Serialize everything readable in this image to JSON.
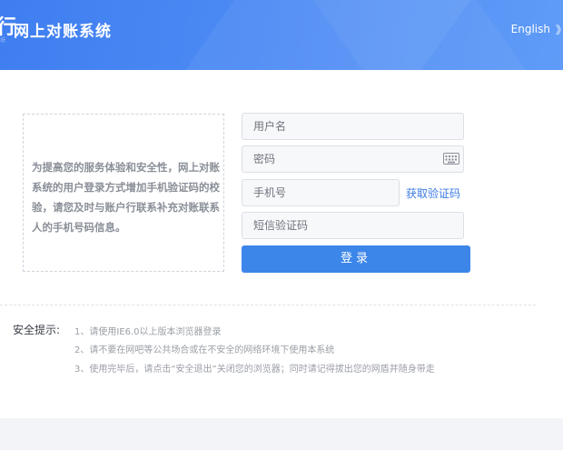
{
  "header": {
    "logo_glyph": "行",
    "logo_small": "工行",
    "title": "网上对账系统",
    "language_link": "English",
    "edge_glyph": "》"
  },
  "notice": {
    "text": "为提高您的服务体验和安全性，网上对账系统的用户登录方式增加手机验证码的校验，请您及时与账户行联系补充对账联系人的手机号码信息。"
  },
  "login_form": {
    "username_placeholder": "用户名",
    "password_placeholder": "密码",
    "phone_placeholder": "手机号",
    "get_code_link": "获取验证码",
    "sms_code_placeholder": "短信验证码",
    "login_button": "登录",
    "keyboard_icon": "keyboard-icon"
  },
  "tips": {
    "label": "安全提示:",
    "items": [
      "1、请使用IE6.0以上版本浏览器登录",
      "2、请不要在网吧等公共场合或在不安全的网络环境下使用本系统",
      "3、使用完毕后，请点击“安全退出”关闭您的浏览器；同时请记得拔出您的网盾并随身带走"
    ]
  },
  "colors": {
    "header_blue": "#4c8af4",
    "button_blue": "#3c86ea",
    "link_blue": "#3b7be6"
  }
}
